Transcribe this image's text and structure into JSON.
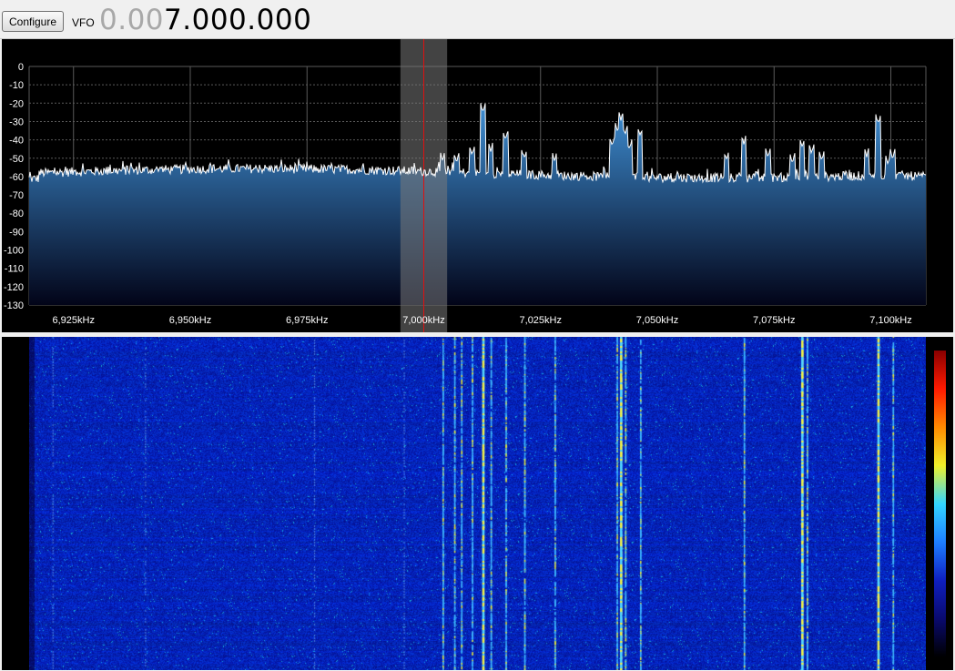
{
  "toolbar": {
    "configure_label": "Configure",
    "vfo_label": "VFO",
    "vfo_dim": "0.00",
    "vfo_main": "7.000.000"
  },
  "spectrum": {
    "y_ticks": [
      0,
      -10,
      -20,
      -30,
      -40,
      -50,
      -60,
      -70,
      -80,
      -90,
      -100,
      -110,
      -120,
      -130
    ],
    "y_range": [
      -130,
      0
    ],
    "x_ticks": [
      {
        "khz": 6925,
        "label": "6,925kHz"
      },
      {
        "khz": 6950,
        "label": "6,950kHz"
      },
      {
        "khz": 6975,
        "label": "6,975kHz"
      },
      {
        "khz": 7000,
        "label": "7,000kHz"
      },
      {
        "khz": 7025,
        "label": "7,025kHz"
      },
      {
        "khz": 7050,
        "label": "7,050kHz"
      },
      {
        "khz": 7075,
        "label": "7,075kHz"
      },
      {
        "khz": 7100,
        "label": "7,100kHz"
      }
    ],
    "x_range_khz": [
      6915.5,
      7107.5
    ],
    "tuned_khz": 7000,
    "filter_range_khz": [
      6995,
      7005
    ],
    "noise_floor_db": -57,
    "peaks": [
      {
        "khz": 7004.0,
        "db": -51
      },
      {
        "khz": 7007.0,
        "db": -52
      },
      {
        "khz": 7010.3,
        "db": -48
      },
      {
        "khz": 7012.7,
        "db": -25
      },
      {
        "khz": 7014.3,
        "db": -46
      },
      {
        "khz": 7017.5,
        "db": -40
      },
      {
        "khz": 7021.5,
        "db": -50
      },
      {
        "khz": 7028.0,
        "db": -51
      },
      {
        "khz": 7040.3,
        "db": -43
      },
      {
        "khz": 7041.5,
        "db": -35
      },
      {
        "khz": 7042.2,
        "db": -29
      },
      {
        "khz": 7043.1,
        "db": -37
      },
      {
        "khz": 7044.0,
        "db": -45
      },
      {
        "khz": 7046.3,
        "db": -38
      },
      {
        "khz": 7064.8,
        "db": -51
      },
      {
        "khz": 7068.5,
        "db": -42
      },
      {
        "khz": 7073.7,
        "db": -49
      },
      {
        "khz": 7078.9,
        "db": -52
      },
      {
        "khz": 7081.0,
        "db": -44
      },
      {
        "khz": 7083.0,
        "db": -47
      },
      {
        "khz": 7085.2,
        "db": -51
      },
      {
        "khz": 7094.8,
        "db": -49
      },
      {
        "khz": 7097.3,
        "db": -31
      },
      {
        "khz": 7099.4,
        "db": -53
      },
      {
        "khz": 7100.4,
        "db": -50
      }
    ],
    "colors": {
      "background": "#000000",
      "grid": "#5a5a5a",
      "trace": "#ffffff",
      "fill_top": "#3f8fd4",
      "fill_bottom": "#020418",
      "filter_band": "#7a7a7a",
      "tuned_line": "#e01010"
    }
  },
  "waterfall": {
    "colormap": [
      "#000000",
      "#0a0a6e",
      "#0f1fc0",
      "#1e7fff",
      "#33d6ff",
      "#f0f02a",
      "#ff8a00",
      "#ff1a00",
      "#8a0000"
    ],
    "signal_khz": [
      7004,
      7006.5,
      7008,
      7010.3,
      7012.7,
      7014.3,
      7017.5,
      7021.5,
      7028,
      7041.3,
      7042.2,
      7043.1,
      7046.3,
      7068.5,
      7081.0,
      7082.0,
      7097.3,
      7100.4
    ],
    "bright_signal_khz": [
      7012.7,
      7042.2,
      7081.0,
      7097.3
    ]
  }
}
